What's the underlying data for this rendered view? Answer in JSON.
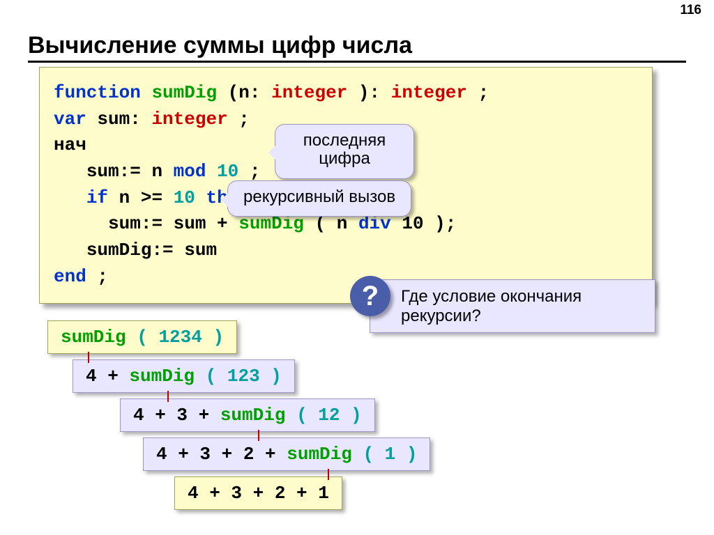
{
  "page_number": "116",
  "title": "Вычисление суммы цифр числа",
  "code": {
    "function_kw": "function",
    "fn_name": "sumDig",
    "param_open": "(n:",
    "type1": "integer",
    "param_close": "):",
    "ret_type": "integer",
    "semi": ";",
    "var_kw": "var",
    "var_name": "sum:",
    "var_type": "integer",
    "begin": "нач",
    "l1_a": "sum:= n",
    "mod_kw": "mod",
    "l1_b": "10",
    "l2_a": "if",
    "l2_b": "n >=",
    "l2_c": "10",
    "then_kw": "then",
    "l3_a": "sum:= sum +",
    "l3_fn": "sumDig",
    "l3_b": "( n",
    "div_kw": "div",
    "l3_c": "10 );",
    "l4": "sumDig:= sum",
    "end": "end",
    "end_semi": ";"
  },
  "callout_last_digit": "последняя\nцифра",
  "callout_recursive": "рекурсивный вызов",
  "question_mark": "?",
  "question_text": "Где условие окончания рекурсии?",
  "steps": {
    "s0_fn": "sumDig",
    "s0_arg": "( 1234 )",
    "s1_pre": "4 + ",
    "s1_fn": "sumDig",
    "s1_arg": "( 123 )",
    "s2_pre": "4 + 3 + ",
    "s2_fn": "sumDig",
    "s2_arg": "( 12 )",
    "s3_pre": "4 + 3 + 2 + ",
    "s3_fn": "sumDig",
    "s3_arg": "( 1 )",
    "s4": "4 + 3 + 2 + 1"
  }
}
